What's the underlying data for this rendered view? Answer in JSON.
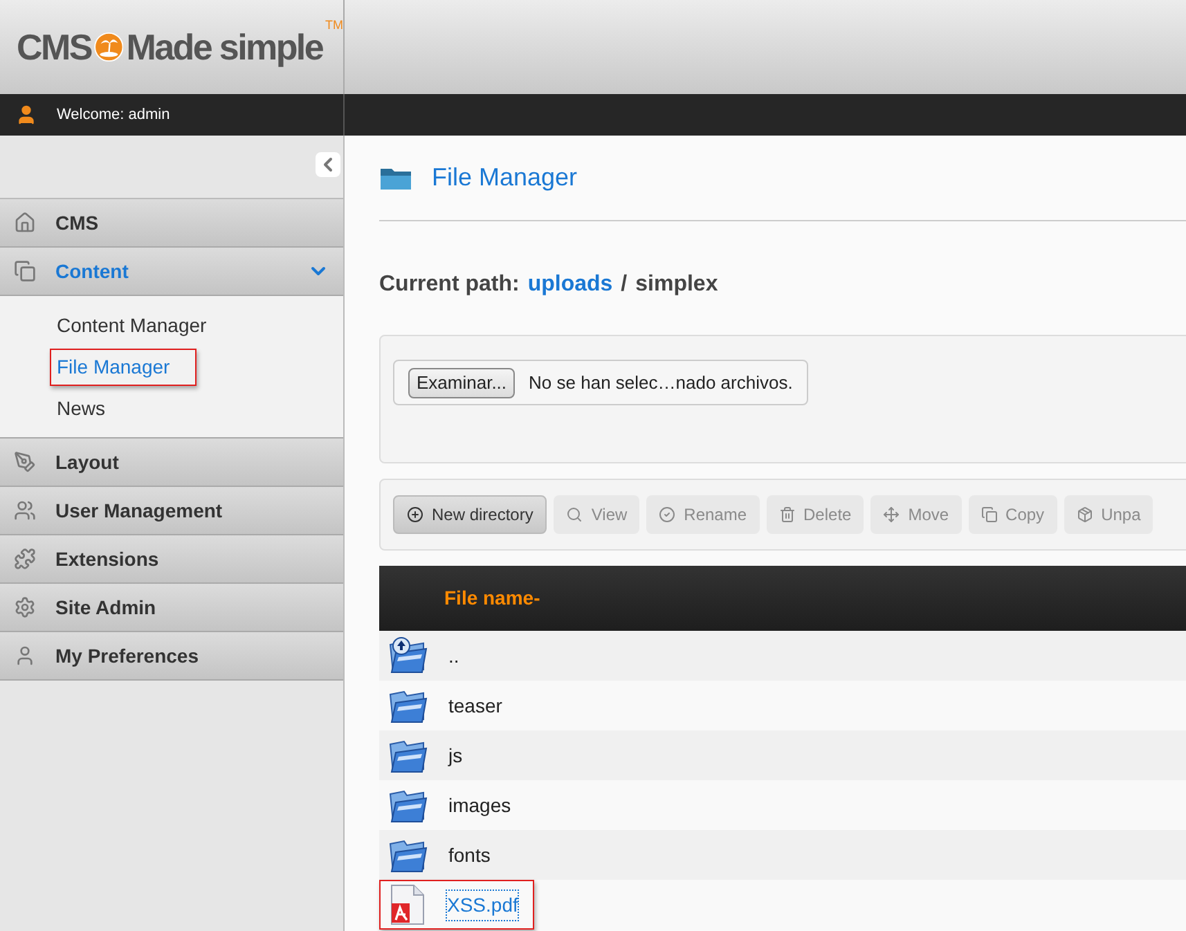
{
  "logo": {
    "left": "CMS",
    "right": "Made simple",
    "trademark": "TM"
  },
  "user_bar": {
    "welcome": "Welcome: admin"
  },
  "sidebar": {
    "items": [
      {
        "label": "CMS",
        "expanded": false,
        "selected": false
      },
      {
        "label": "Content",
        "expanded": true,
        "selected": true,
        "children": [
          {
            "label": "Content Manager",
            "selected": false,
            "annotated": false
          },
          {
            "label": "File Manager",
            "selected": true,
            "annotated": true
          },
          {
            "label": "News",
            "selected": false,
            "annotated": false
          }
        ]
      },
      {
        "label": "Layout",
        "expanded": false,
        "selected": false
      },
      {
        "label": "User Management",
        "expanded": false,
        "selected": false
      },
      {
        "label": "Extensions",
        "expanded": false,
        "selected": false
      },
      {
        "label": "Site Admin",
        "expanded": false,
        "selected": false
      },
      {
        "label": "My Preferences",
        "expanded": false,
        "selected": false
      }
    ]
  },
  "page": {
    "title": "File Manager",
    "path_label": "Current path:",
    "path": [
      {
        "label": "uploads",
        "link": true
      },
      {
        "label": "/",
        "link": false
      },
      {
        "label": "simplex",
        "link": false
      }
    ]
  },
  "upload": {
    "button": "Examinar...",
    "status": "No se han selec…nado archivos."
  },
  "toolbar": [
    {
      "label": "New directory",
      "disabled": false
    },
    {
      "label": "View",
      "disabled": true
    },
    {
      "label": "Rename",
      "disabled": true
    },
    {
      "label": "Delete",
      "disabled": true
    },
    {
      "label": "Move",
      "disabled": true
    },
    {
      "label": "Copy",
      "disabled": true
    },
    {
      "label": "Unpa",
      "disabled": true
    }
  ],
  "table": {
    "columns": [
      "File name-"
    ],
    "rows": [
      {
        "name": "..",
        "kind": "parent",
        "link": false,
        "annotated": false
      },
      {
        "name": "teaser",
        "kind": "folder",
        "link": false,
        "annotated": false
      },
      {
        "name": "js",
        "kind": "folder",
        "link": false,
        "annotated": false
      },
      {
        "name": "images",
        "kind": "folder",
        "link": false,
        "annotated": false
      },
      {
        "name": "fonts",
        "kind": "folder",
        "link": false,
        "annotated": false
      },
      {
        "name": "XSS.pdf",
        "kind": "pdf",
        "link": true,
        "annotated": true
      }
    ]
  }
}
